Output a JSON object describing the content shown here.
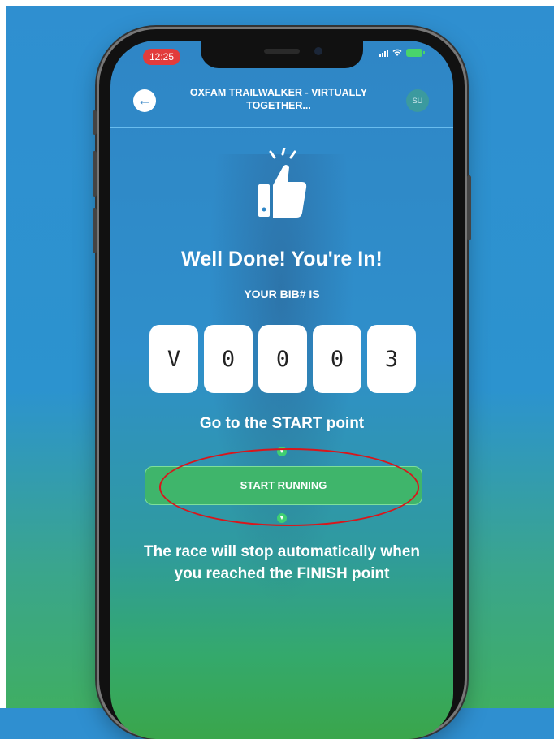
{
  "status_bar": {
    "time": "12:25"
  },
  "header": {
    "title": "OXFAM TRAILWALKER - VIRTUALLY TOGETHER...",
    "avatar_initials": "SU",
    "back_icon": "arrow-left-icon"
  },
  "main": {
    "headline": "Well Done! You're In!",
    "bib_label": "YOUR BIB# IS",
    "bib_digits": [
      "V",
      "0",
      "0",
      "0",
      "3"
    ],
    "start_point_text": "Go to the START point",
    "start_button_label": "START RUNNING",
    "finish_text": "The race will stop automatically when you reached the FINISH point"
  },
  "colors": {
    "accent_green": "#3fb56b",
    "highlight_red": "#d9161b",
    "status_red": "#e23b3b"
  }
}
